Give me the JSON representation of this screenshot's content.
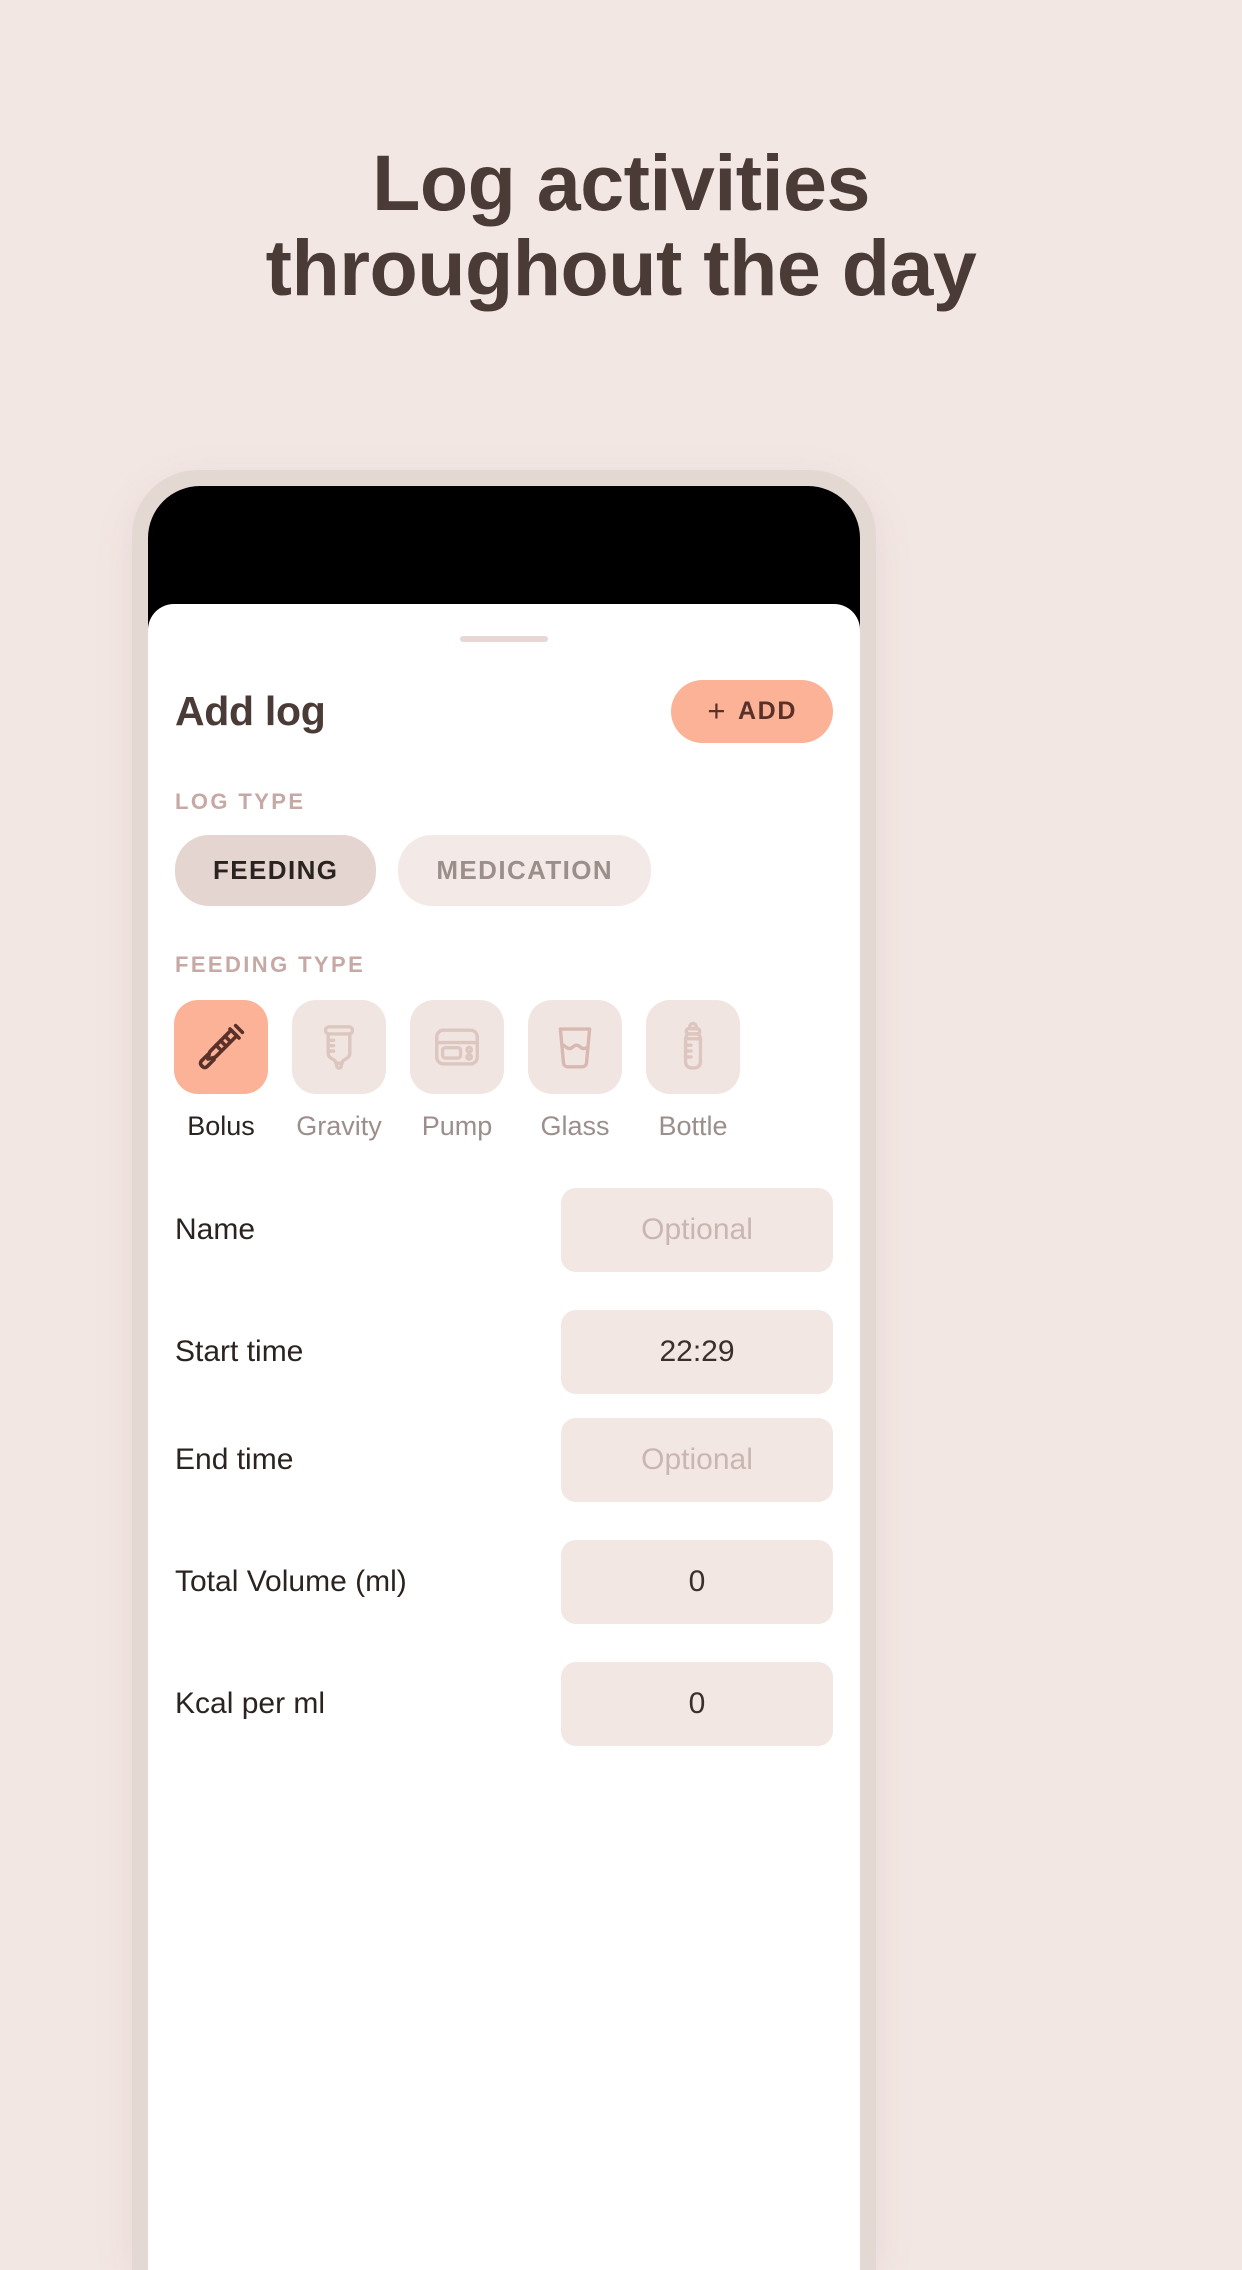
{
  "promo": {
    "headline_line1": "Log activities",
    "headline_line2": "throughout the day",
    "background_color": "#f3e7e4",
    "text_color": "#4a3b37"
  },
  "sheet": {
    "title": "Add log",
    "add_button": {
      "label": "ADD",
      "plus": "+",
      "color": "#fbb296"
    }
  },
  "log_type": {
    "label": "LOG TYPE",
    "options": [
      {
        "label": "FEEDING",
        "selected": true
      },
      {
        "label": "MEDICATION",
        "selected": false
      }
    ]
  },
  "feeding_type": {
    "label": "FEEDING TYPE",
    "options": [
      {
        "label": "Bolus",
        "icon": "syringe-icon",
        "selected": true
      },
      {
        "label": "Gravity",
        "icon": "feeding-bag-icon",
        "selected": false
      },
      {
        "label": "Pump",
        "icon": "pump-device-icon",
        "selected": false
      },
      {
        "label": "Glass",
        "icon": "water-glass-icon",
        "selected": false
      },
      {
        "label": "Bottle",
        "icon": "baby-bottle-icon",
        "selected": false
      }
    ]
  },
  "form": {
    "rows": [
      {
        "label": "Name",
        "value": "",
        "placeholder": "Optional"
      },
      {
        "label": "Start time",
        "value": "22:29",
        "placeholder": ""
      },
      {
        "label": "End time",
        "value": "",
        "placeholder": "Optional"
      },
      {
        "label": "Total Volume (ml)",
        "value": "0",
        "placeholder": ""
      },
      {
        "label": "Kcal per ml",
        "value": "0",
        "placeholder": ""
      }
    ]
  }
}
